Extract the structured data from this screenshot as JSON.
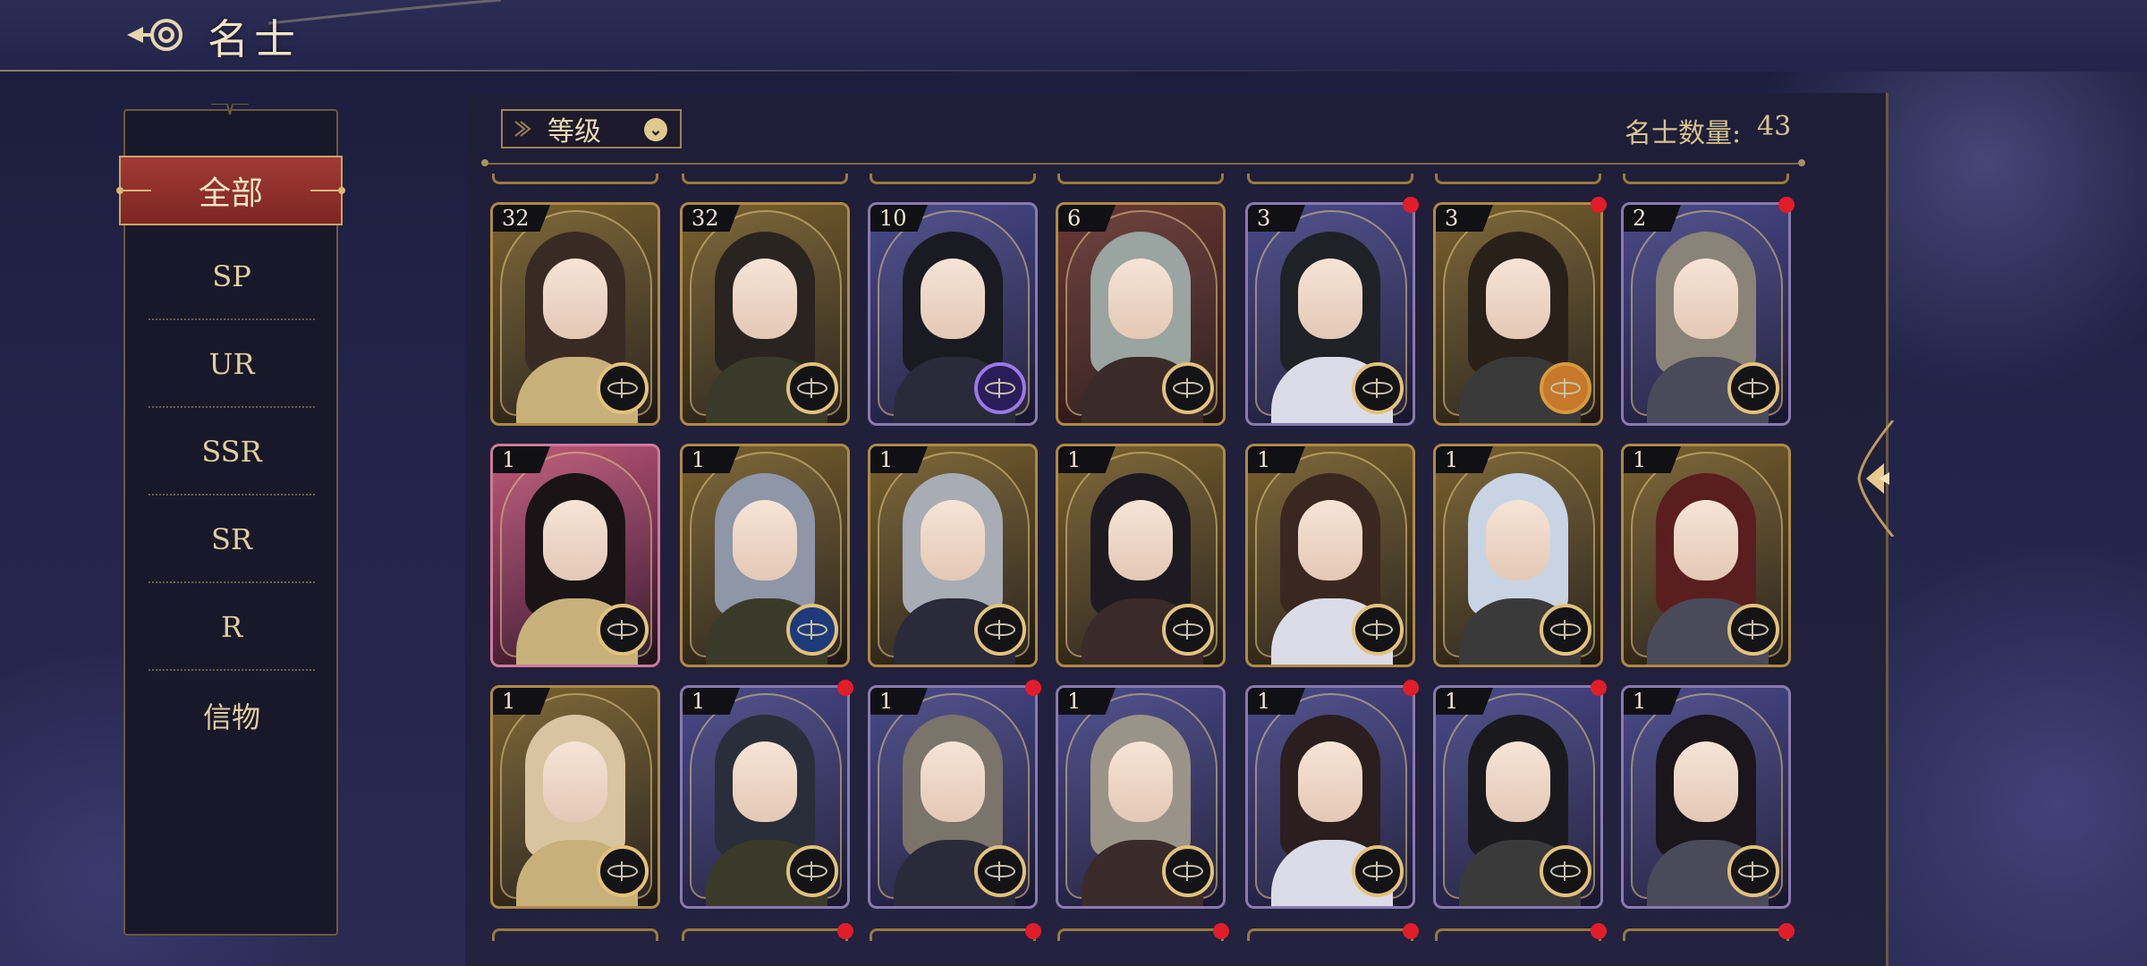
{
  "header": {
    "title": "名士"
  },
  "sidebar": {
    "active": "全部",
    "items": [
      "SP",
      "UR",
      "SSR",
      "SR",
      "R",
      "信物"
    ]
  },
  "toolbar": {
    "sort_label": "等级",
    "count_label": "名士数量:",
    "count_value": "43"
  },
  "colors": {
    "accent_red": "#a23a34",
    "gold": "#e4c27a",
    "notify": "#e11d2a"
  },
  "cards": [
    {
      "level": "32",
      "frame": "gold",
      "emblem": "gold",
      "dot": false
    },
    {
      "level": "32",
      "frame": "gold",
      "emblem": "gold",
      "dot": false
    },
    {
      "level": "10",
      "frame": "purple",
      "emblem": "violet",
      "dot": false
    },
    {
      "level": "6",
      "frame": "red",
      "emblem": "gold",
      "dot": false
    },
    {
      "level": "3",
      "frame": "purple",
      "emblem": "gold",
      "dot": true
    },
    {
      "level": "3",
      "frame": "gold",
      "emblem": "amber",
      "dot": true
    },
    {
      "level": "2",
      "frame": "purple",
      "emblem": "gold",
      "dot": true
    },
    {
      "level": "1",
      "frame": "pink",
      "emblem": "gold",
      "dot": false
    },
    {
      "level": "1",
      "frame": "gold",
      "emblem": "blue",
      "dot": false
    },
    {
      "level": "1",
      "frame": "gold",
      "emblem": "gold",
      "dot": false
    },
    {
      "level": "1",
      "frame": "gold",
      "emblem": "gold",
      "dot": false
    },
    {
      "level": "1",
      "frame": "gold",
      "emblem": "gold",
      "dot": false
    },
    {
      "level": "1",
      "frame": "gold",
      "emblem": "gold",
      "dot": false
    },
    {
      "level": "1",
      "frame": "gold",
      "emblem": "gold",
      "dot": false
    },
    {
      "level": "1",
      "frame": "gold",
      "emblem": "gold",
      "dot": false
    },
    {
      "level": "1",
      "frame": "purple",
      "emblem": "gold",
      "dot": true
    },
    {
      "level": "1",
      "frame": "purple",
      "emblem": "gold",
      "dot": true
    },
    {
      "level": "1",
      "frame": "purple",
      "emblem": "gold",
      "dot": false
    },
    {
      "level": "1",
      "frame": "purple",
      "emblem": "gold",
      "dot": true
    },
    {
      "level": "1",
      "frame": "purple",
      "emblem": "gold",
      "dot": true
    },
    {
      "level": "1",
      "frame": "purple",
      "emblem": "gold",
      "dot": false
    }
  ]
}
